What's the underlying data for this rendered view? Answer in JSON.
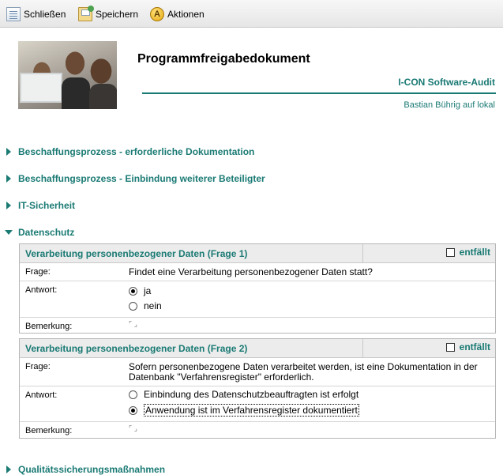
{
  "toolbar": {
    "close_label": "Schließen",
    "save_label": "Speichern",
    "actions_label": "Aktionen",
    "actions_icon_letter": "A"
  },
  "header": {
    "title": "Programmfreigabedokument",
    "subtitle": "I-CON Software-Audit",
    "user": "Bastian Bührig auf lokal"
  },
  "sections": [
    {
      "label": "Beschaffungsprozess - erforderliche Dokumentation",
      "expanded": false
    },
    {
      "label": "Beschaffungsprozess - Einbindung weiterer Beteiligter",
      "expanded": false
    },
    {
      "label": "IT-Sicherheit",
      "expanded": false
    },
    {
      "label": "Datenschutz",
      "expanded": true
    },
    {
      "label": "Qualitätssicherungsmaßnahmen",
      "expanded": false
    }
  ],
  "questions": [
    {
      "title": "Verarbeitung personenbezogener Daten (Frage 1)",
      "entfaellt_label": "entfällt",
      "frage_label": "Frage:",
      "frage_text": "Findet eine Verarbeitung personenbezogener Daten statt?",
      "antwort_label": "Antwort:",
      "options": [
        {
          "label": "ja",
          "selected": true
        },
        {
          "label": "nein",
          "selected": false
        }
      ],
      "bemerkung_label": "Bemerkung:"
    },
    {
      "title": "Verarbeitung personenbezogener Daten (Frage 2)",
      "entfaellt_label": "entfällt",
      "frage_label": "Frage:",
      "frage_text": "Sofern personenbezogene Daten verarbeitet werden, ist eine Dokumentation in der Datenbank \"Verfahrensregister\" erforderlich.",
      "antwort_label": "Antwort:",
      "options": [
        {
          "label": "Einbindung des Datenschutzbeauftragten ist erfolgt",
          "selected": false
        },
        {
          "label": "Anwendung ist im Verfahrensregister dokumentiert",
          "selected": true
        }
      ],
      "bemerkung_label": "Bemerkung:"
    }
  ],
  "colors": {
    "accent": "#1a7a74",
    "bar_bg": "#ececec",
    "border": "#b7b7b7"
  },
  "icons": {
    "close": "close-document-icon",
    "save": "save-icon",
    "actions": "actions-icon",
    "collapsed": "triangle-right-icon",
    "expanded": "triangle-down-icon",
    "remark": "remark-field-icon"
  }
}
